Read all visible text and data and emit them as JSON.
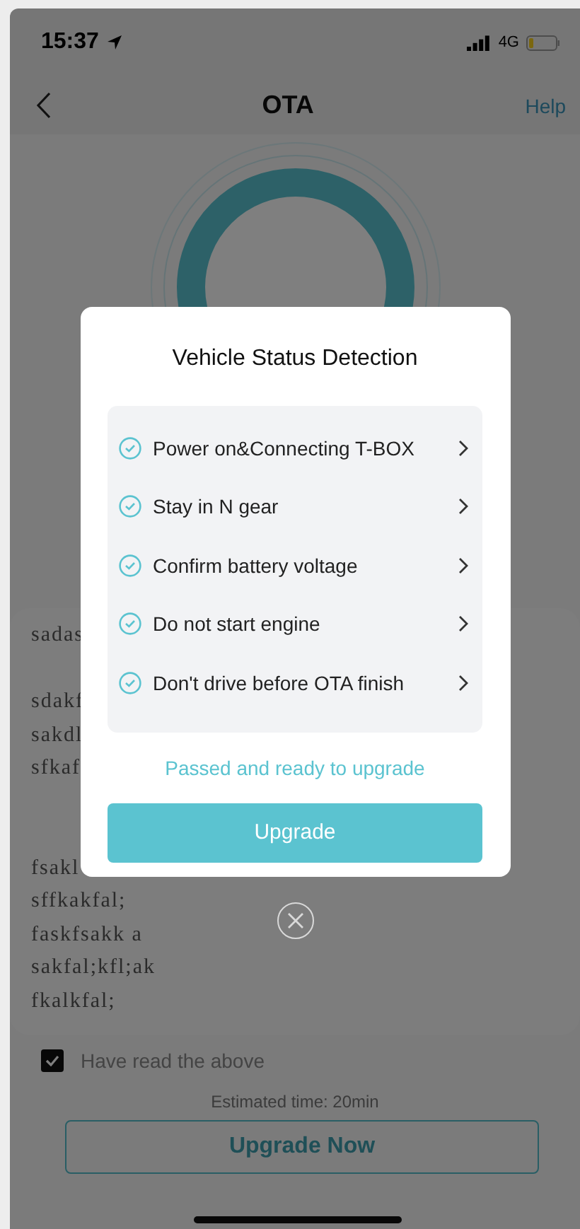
{
  "status_bar": {
    "time": "15:37",
    "network": "4G"
  },
  "nav": {
    "title": "OTA",
    "action": "Help"
  },
  "notes": {
    "paragraphs": [
      [
        "sadas"
      ],
      [
        "sdakf",
        "sakdl",
        "sfkaf"
      ],
      [
        "fsakl",
        "sffkakfal;",
        "faskfsakk a",
        "sakfal;kfl;ak",
        "fkalkfal;"
      ]
    ]
  },
  "agreement": {
    "label": "Have read the above",
    "checked": true
  },
  "estimate": "Estimated time: 20min",
  "primary_button": "Upgrade Now",
  "dialog": {
    "title": "Vehicle Status Detection",
    "checks": [
      {
        "label": "Power on&Connecting T-BOX",
        "checked": true
      },
      {
        "label": "Stay in N gear",
        "checked": true
      },
      {
        "label": "Confirm battery voltage",
        "checked": true
      },
      {
        "label": "Do not start engine",
        "checked": true
      },
      {
        "label": "Don't drive before OTA finish",
        "checked": true
      }
    ],
    "result": "Passed and ready to upgrade",
    "button": "Upgrade"
  }
}
